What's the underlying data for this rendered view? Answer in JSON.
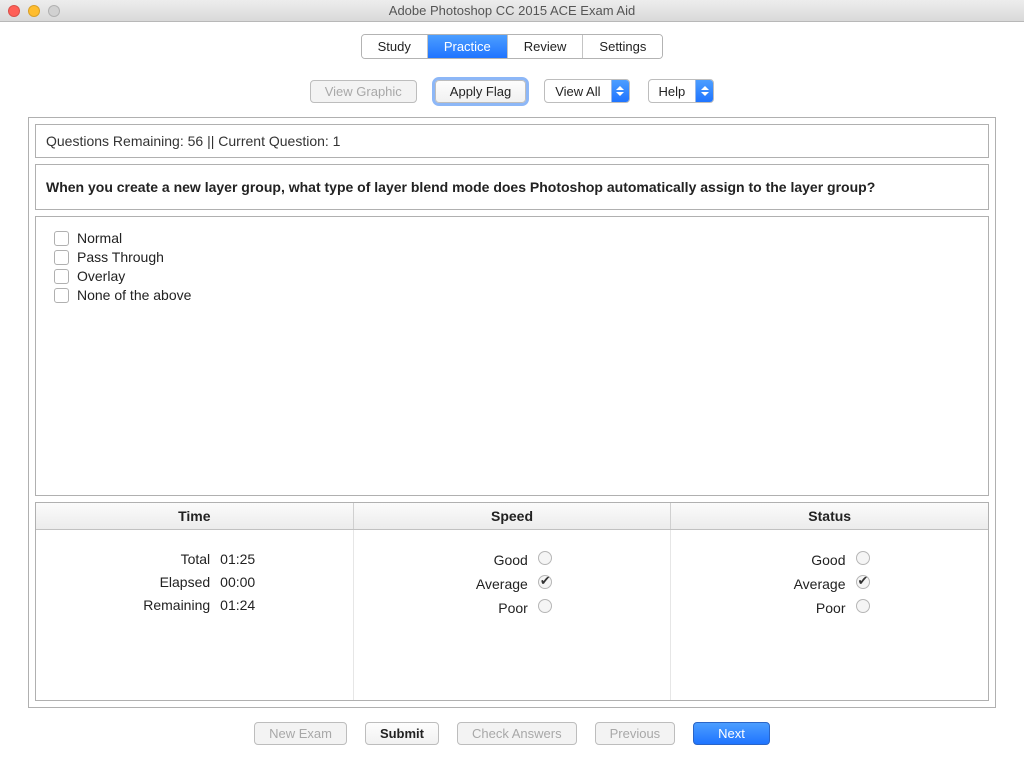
{
  "window": {
    "title": "Adobe Photoshop CC 2015 ACE Exam Aid"
  },
  "tabs": {
    "study": "Study",
    "practice": "Practice",
    "review": "Review",
    "settings": "Settings",
    "active": "practice"
  },
  "toolbar": {
    "view_graphic": "View Graphic",
    "apply_flag": "Apply Flag",
    "view_filter": "View All",
    "help": "Help"
  },
  "status_line": {
    "questions_remaining_label": "Questions Remaining:",
    "questions_remaining_value": "56",
    "separator": "||",
    "current_question_label": "Current Question:",
    "current_question_value": "1"
  },
  "question": "When you create a new layer group, what type of layer blend mode does Photoshop automatically assign to the layer group?",
  "answers": [
    {
      "label": "Normal",
      "checked": false
    },
    {
      "label": "Pass Through",
      "checked": false
    },
    {
      "label": "Overlay",
      "checked": false
    },
    {
      "label": "None of the above",
      "checked": false
    }
  ],
  "stats": {
    "headers": {
      "time": "Time",
      "speed": "Speed",
      "status": "Status"
    },
    "time": {
      "total_label": "Total",
      "total_value": "01:25",
      "elapsed_label": "Elapsed",
      "elapsed_value": "00:00",
      "remaining_label": "Remaining",
      "remaining_value": "01:24"
    },
    "speed": {
      "good": "Good",
      "average": "Average",
      "poor": "Poor",
      "selected": "average"
    },
    "status": {
      "good": "Good",
      "average": "Average",
      "poor": "Poor",
      "selected": "average"
    }
  },
  "footer": {
    "new_exam": "New Exam",
    "submit": "Submit",
    "check_answers": "Check Answers",
    "previous": "Previous",
    "next": "Next"
  }
}
